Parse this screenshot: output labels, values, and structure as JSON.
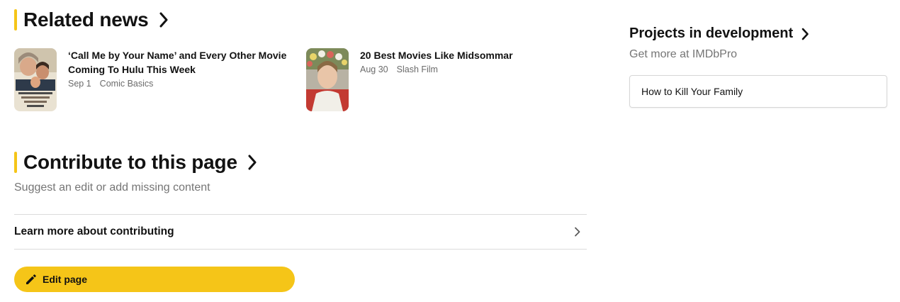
{
  "colors": {
    "accent": "#f5c518",
    "text": "#121212",
    "muted": "#757575"
  },
  "related_news": {
    "heading": "Related news",
    "items": [
      {
        "headline": "‘Call Me by Your Name’ and Every Other Movie Coming To Hulu This Week",
        "date": "Sep 1",
        "source": "Comic Basics",
        "thumb": "mrs-doubtfire-poster-image"
      },
      {
        "headline": "20 Best Movies Like Midsommar",
        "date": "Aug 30",
        "source": "Slash Film",
        "thumb": "midsommar-still-image"
      }
    ]
  },
  "contribute": {
    "heading": "Contribute to this page",
    "subtitle": "Suggest an edit or add missing content",
    "learn_more": "Learn more about contributing",
    "edit_label": "Edit page"
  },
  "projects": {
    "title": "Projects in development",
    "subtitle": "Get more at IMDbPro",
    "items": [
      "How to Kill Your Family"
    ]
  }
}
